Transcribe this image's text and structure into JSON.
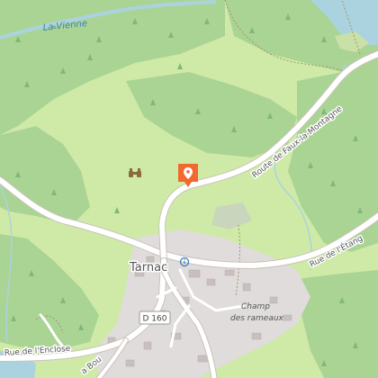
{
  "map": {
    "place_name": "Tarnac",
    "river_name": "La Vienne",
    "roads": {
      "road_top": "Route de Faux-la-Montagne",
      "road_east": "Rue de l'Étang",
      "road_southwest": "Rue de l'Enclose",
      "road_bottom": "a Bou"
    },
    "route_shield": "D 160",
    "area_label": "Champ des rameaux",
    "area_label_line1": "Champ",
    "area_label_line2": "des rameaux",
    "colors": {
      "forest": "#aad494",
      "meadow": "#cfeaa7",
      "residential": "#e0dcdc",
      "water": "#aad3df",
      "road": "#ffffff",
      "marker": "#f2682f",
      "label": "#555555",
      "river_label": "#3f7fbf"
    },
    "icons": [
      "location-pin-icon",
      "binoculars-icon",
      "info-icon"
    ]
  }
}
